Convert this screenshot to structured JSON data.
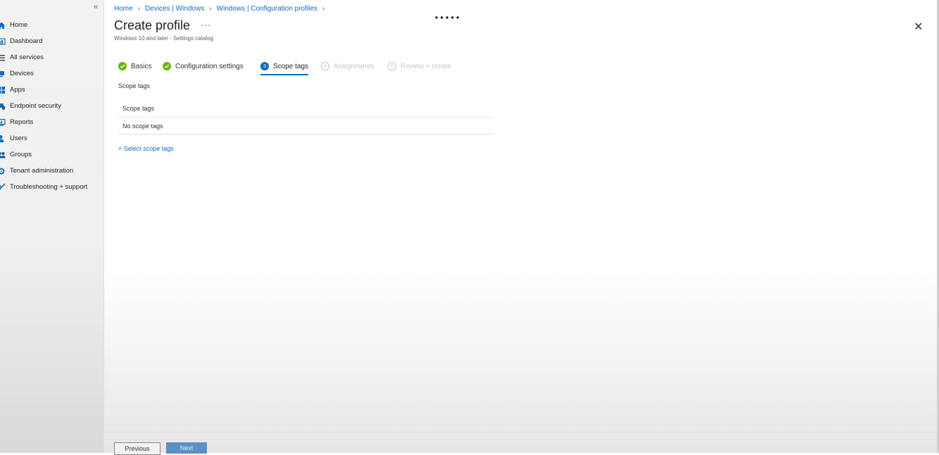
{
  "sidebar": {
    "collapse_label": "«",
    "items": [
      {
        "label": "Home",
        "icon": "home-icon",
        "color": "#0f6cbd"
      },
      {
        "label": "Dashboard",
        "icon": "dashboard-icon",
        "color": "#0f6cbd"
      },
      {
        "label": "All services",
        "icon": "all-services-icon",
        "color": "#323130"
      },
      {
        "label": "Devices",
        "icon": "devices-icon",
        "color": "#0f6cbd"
      },
      {
        "label": "Apps",
        "icon": "apps-icon",
        "color": "#0f6cbd"
      },
      {
        "label": "Endpoint security",
        "icon": "shield-icon",
        "color": "#0f6cbd"
      },
      {
        "label": "Reports",
        "icon": "reports-icon",
        "color": "#0f6cbd"
      },
      {
        "label": "Users",
        "icon": "users-icon",
        "color": "#0f6cbd"
      },
      {
        "label": "Groups",
        "icon": "groups-icon",
        "color": "#0f6cbd"
      },
      {
        "label": "Tenant administration",
        "icon": "gear-icon",
        "color": "#0f6cbd"
      },
      {
        "label": "Troubleshooting + support",
        "icon": "wrench-icon",
        "color": "#0f6cbd"
      }
    ]
  },
  "breadcrumb": [
    "Home",
    "Devices | Windows",
    "Windows | Configuration profiles"
  ],
  "header": {
    "title": "Create profile",
    "more": "···",
    "subtitle": "Windows 10 and later - Settings catalog",
    "dots": "•      •      •    •     •",
    "close": "✕"
  },
  "steps": [
    {
      "label": "Basics",
      "state": "done",
      "marker": "✓"
    },
    {
      "label": "Configuration settings",
      "state": "done",
      "marker": "✓"
    },
    {
      "label": "Scope tags",
      "state": "active",
      "marker": "3"
    },
    {
      "label": "Assignments",
      "state": "disabled",
      "marker": "4"
    },
    {
      "label": "Review + create",
      "state": "disabled",
      "marker": "5"
    }
  ],
  "content": {
    "section_label": "Scope tags",
    "table_header": "Scope tags",
    "table_row": "No scope tags",
    "select_link": "+ Select scope tags"
  },
  "footer": {
    "previous": "Previous",
    "next": "Next"
  },
  "colors": {
    "accent": "#0f6cbd",
    "success": "#6bb700",
    "disabled": "#c8c6c4"
  }
}
